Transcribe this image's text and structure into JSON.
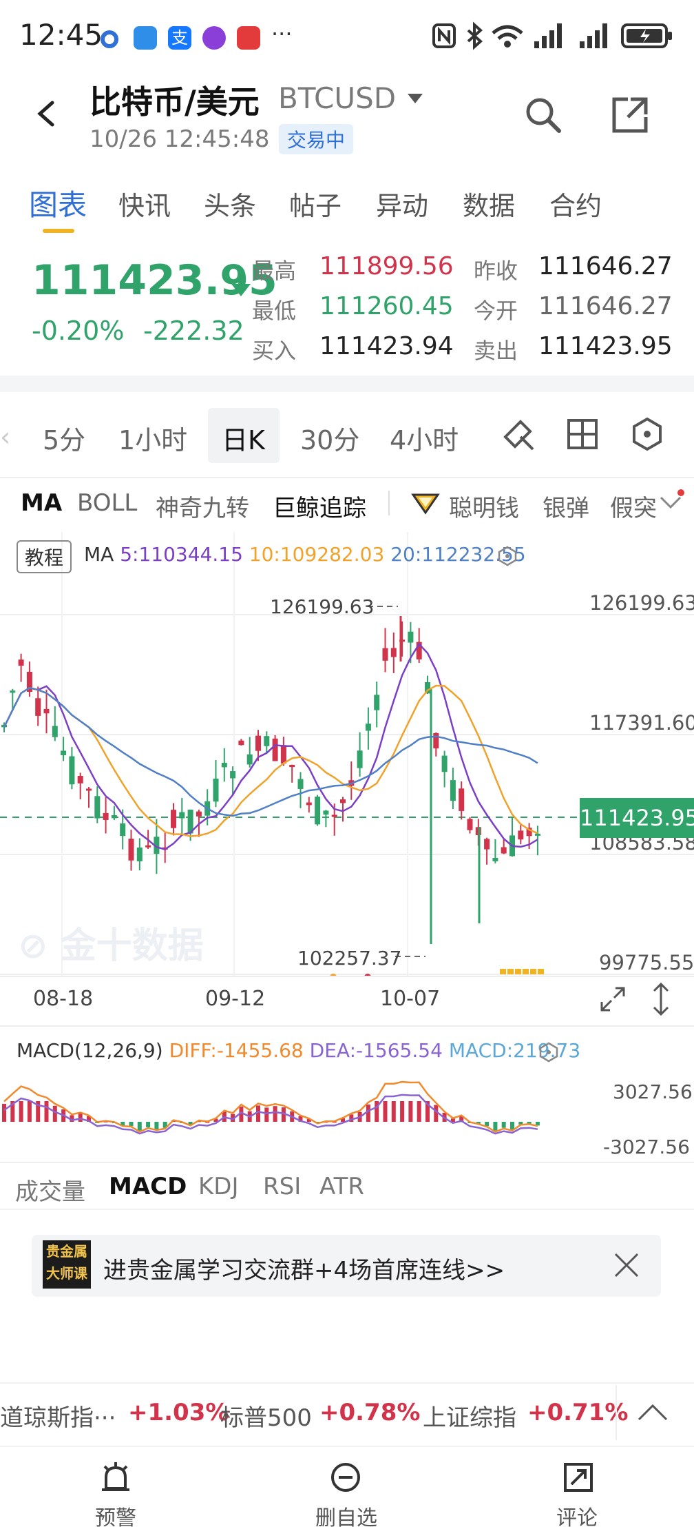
{
  "status_bar": {
    "time": "12:45",
    "more": "···"
  },
  "header": {
    "title": "比特币/美元",
    "symbol": "BTCUSD",
    "datetime": "10/26 12:45:48",
    "badge": "交易中"
  },
  "tabs": [
    "图表",
    "快讯",
    "头条",
    "帖子",
    "异动",
    "数据",
    "合约"
  ],
  "quote": {
    "price": "111423.95",
    "change_pct": "-0.20%",
    "change_abs": "-222.32",
    "high_label": "最高",
    "high": "111899.56",
    "low_label": "最低",
    "low": "111260.45",
    "bid_label": "买入",
    "bid": "111423.94",
    "prev_close_label": "昨收",
    "prev_close": "111646.27",
    "open_label": "今开",
    "open": "111646.27",
    "ask_label": "卖出",
    "ask": "111423.95"
  },
  "periods": [
    "5分",
    "1小时",
    "日K",
    "30分",
    "4小时"
  ],
  "indicators": [
    "MA",
    "BOLL",
    "神奇九转",
    "巨鲸追踪",
    "聪明钱",
    "银弹",
    "假突"
  ],
  "chart": {
    "tutorial": "教程",
    "ma_label": "MA",
    "ma5": "5:110344.15",
    "ma10": "10:109282.03",
    "ma20": "20:112232.55",
    "y_labels": [
      "126199.63",
      "117391.60",
      "108583.58",
      "99775.55"
    ],
    "high_marker": "126199.63",
    "low_marker": "102257.37",
    "current_tag": "111423.95",
    "x_labels": [
      "08-18",
      "09-12",
      "10-07"
    ],
    "colors": {
      "up": "#d1334b",
      "down": "#2fa36a",
      "ma5": "#7b3fc6",
      "ma10": "#f0a22a",
      "ma20": "#4f7fc6"
    }
  },
  "macd": {
    "title": "MACD(12,26,9)",
    "diff": "DIFF:-1455.68",
    "dea": "DEA:-1565.54",
    "macd": "MACD:219.73",
    "top": "3027.56",
    "bottom": "-3027.56"
  },
  "sub_indicators": [
    "成交量",
    "MACD",
    "KDJ",
    "RSI",
    "ATR"
  ],
  "banner": {
    "logo_line1": "贵金属",
    "logo_line2": "大师课",
    "text": "进贵金属学习交流群+4场首席连线>>"
  },
  "ticker": [
    {
      "name": "道琼斯指···",
      "value": "+1.03%"
    },
    {
      "name": "标普500",
      "value": "+0.78%"
    },
    {
      "name": "上证综指",
      "value": "+0.71%"
    }
  ],
  "bottom_nav": [
    "预警",
    "删自选",
    "评论"
  ],
  "chart_data": {
    "type": "candlestick",
    "x_ticks": [
      "08-18",
      "09-12",
      "10-07"
    ],
    "y_ticks": [
      126199.63,
      117391.6,
      108583.58,
      99775.55
    ],
    "ylim": [
      99775.55,
      126199.63
    ],
    "current": 111423.95,
    "high": 126199.63,
    "low": 102257.37,
    "series": [
      {
        "name": "MA5",
        "last": 110344.15
      },
      {
        "name": "MA10",
        "last": 109282.03
      },
      {
        "name": "MA20",
        "last": 112232.55
      }
    ]
  }
}
